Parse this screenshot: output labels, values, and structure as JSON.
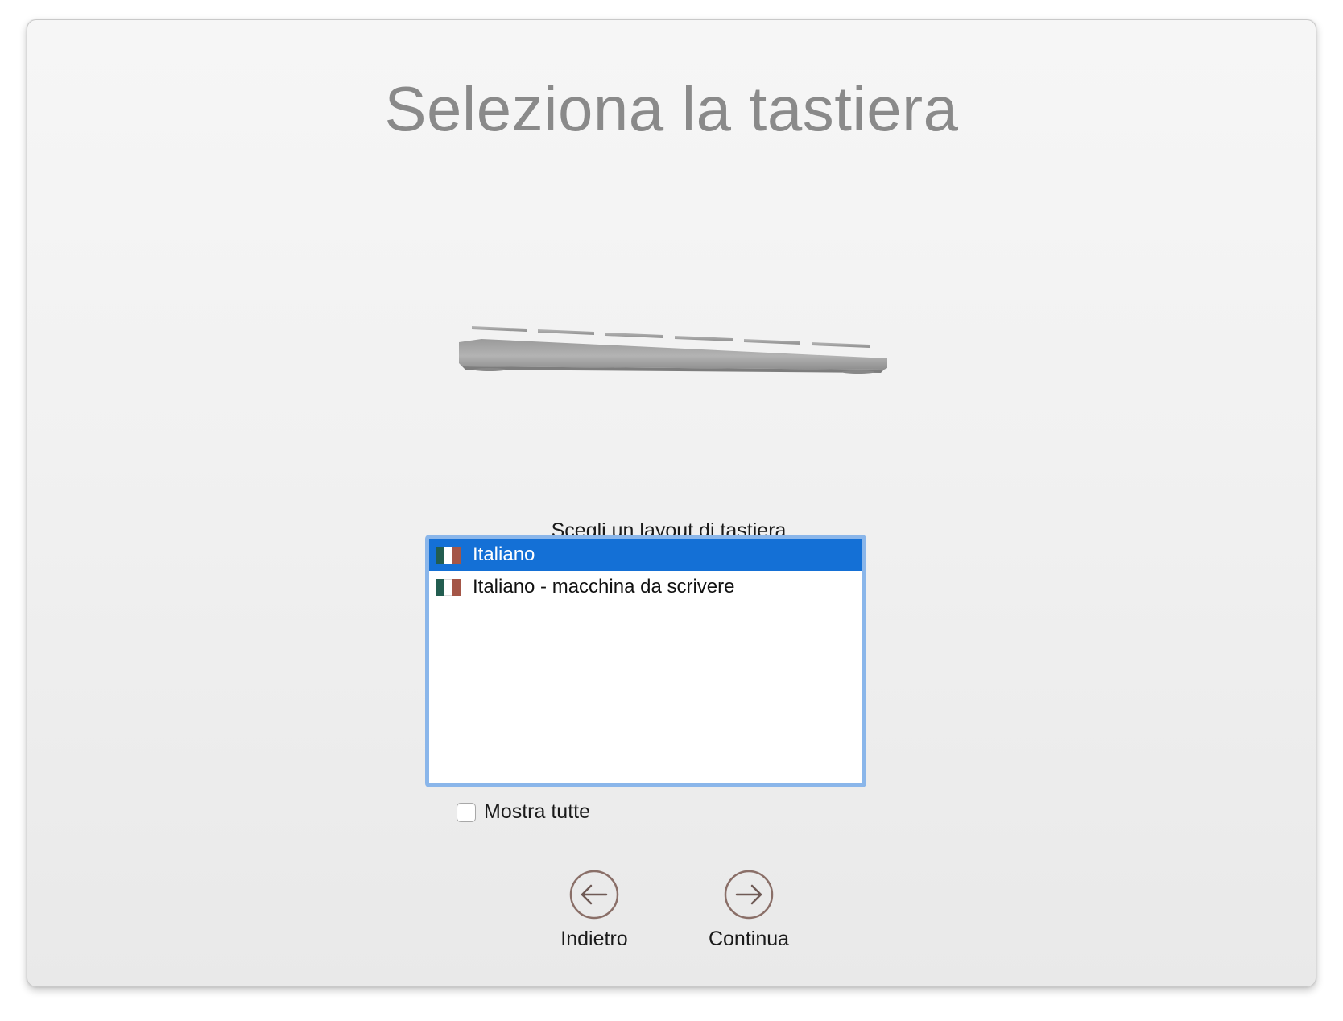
{
  "window": {
    "title": "Seleziona la tastiera"
  },
  "illustration": {
    "icon": "keyboard-illustration"
  },
  "layout_picker": {
    "prompt": "Scegli un layout di tastiera.",
    "items": [
      {
        "label": "Italiano",
        "flag": "italian-flag-icon",
        "selected": true
      },
      {
        "label": "Italiano - macchina da scrivere",
        "flag": "italian-flag-icon",
        "selected": false
      }
    ],
    "selection_color": "#1470d6",
    "focus_ring_color": "#8ab6ea"
  },
  "show_all": {
    "label": "Mostra tutte",
    "checked": false
  },
  "navigation": {
    "back_label": "Indietro",
    "continue_label": "Continua",
    "back_icon": "arrow-left-circle-icon",
    "continue_icon": "arrow-right-circle-icon"
  }
}
